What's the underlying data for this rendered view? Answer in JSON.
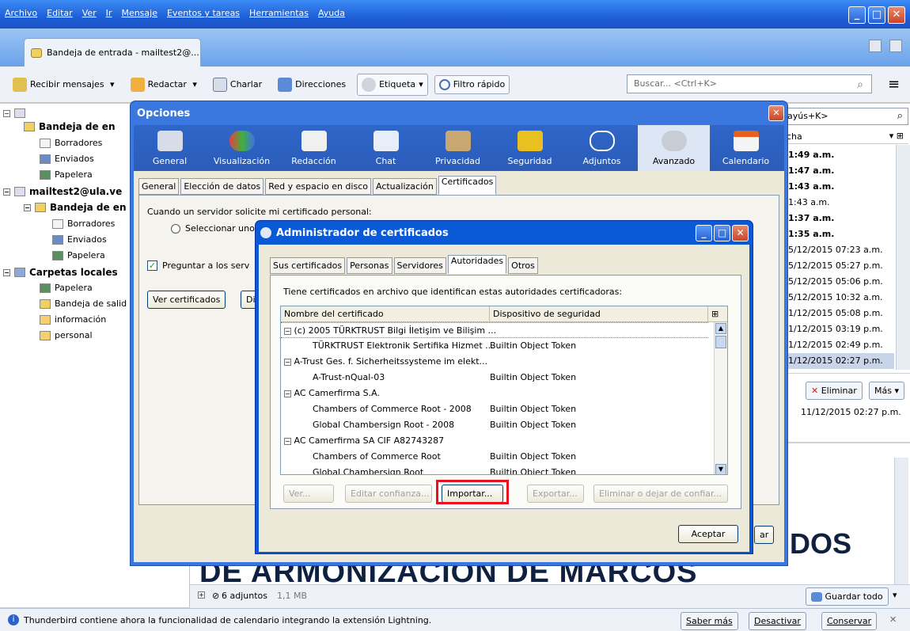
{
  "menu": [
    "Archivo",
    "Editar",
    "Ver",
    "Ir",
    "Mensaje",
    "Eventos y tareas",
    "Herramientas",
    "Ayuda"
  ],
  "tab": {
    "label": "Bandeja de entrada - mailtest2@..."
  },
  "toolbar": {
    "recibir": "Recibir mensajes",
    "redactar": "Redactar",
    "charlar": "Charlar",
    "direcciones": "Direcciones",
    "etiqueta": "Etiqueta",
    "filtro": "Filtro rápido",
    "search_placeholder": "Buscar... <Ctrl+K>"
  },
  "folders": {
    "account1_inbox": "Bandeja de en",
    "account1_borradores": "Borradores",
    "account1_enviados": "Enviados",
    "account1_papelera": "Papelera",
    "account2": "mailtest2@ula.ve",
    "account2_inbox": "Bandeja de en",
    "account2_borradores": "Borradores",
    "account2_enviados": "Enviados",
    "account2_papelera": "Papelera",
    "local": "Carpetas locales",
    "local_papelera": "Papelera",
    "local_salida": "Bandeja de salid",
    "local_informacion": "información",
    "local_personal": "personal"
  },
  "msglist": {
    "search": "ayús+K>",
    "col_fecha": "cha",
    "rows": [
      "1:49 a.m.",
      "1:47 a.m.",
      "1:43 a.m.",
      "1:43 a.m.",
      "1:37 a.m.",
      "1:35 a.m.",
      "5/12/2015 07:23 a.m.",
      "5/12/2015 05:27 p.m.",
      "5/12/2015 05:06 p.m.",
      "5/12/2015 10:32 a.m.",
      "1/12/2015 05:08 p.m.",
      "1/12/2015 03:19 p.m.",
      "1/12/2015 02:49 p.m.",
      "1/12/2015 02:27 p.m."
    ]
  },
  "preview": {
    "eliminar": "Eliminar",
    "mas": "Más",
    "date": "11/12/2015 02:27 p.m.",
    "big1": "DOS",
    "big2": "DE ARMONIZACION DE MARCOS",
    "attachments": "6 adjuntos",
    "att_size": "1,1 MB",
    "guardar_todo": "Guardar todo"
  },
  "status": {
    "message": "Thunderbird contiene ahora la funcionalidad de calendario integrando la extensión Lightning.",
    "saber_mas": "Saber más",
    "desactivar": "Desactivar",
    "conservar": "Conservar"
  },
  "opciones": {
    "title": "Opciones",
    "categories": [
      "General",
      "Visualización",
      "Redacción",
      "Chat",
      "Privacidad",
      "Seguridad",
      "Adjuntos",
      "Avanzado",
      "Calendario"
    ],
    "subtabs": [
      "General",
      "Elección de datos",
      "Red y espacio en disco",
      "Actualización",
      "Certificados"
    ],
    "cert_prompt": "Cuando un servidor solicite mi certificado personal:",
    "radio1": "Seleccionar uno",
    "check1": "Preguntar a los serv",
    "ver_cert": "Ver certificados",
    "dis": "Dis",
    "aceptar_partial": "ar"
  },
  "certmgr": {
    "title": "Administrador de certificados",
    "tabs": [
      "Sus certificados",
      "Personas",
      "Servidores",
      "Autoridades",
      "Otros"
    ],
    "desc": "Tiene certificados en archivo que identifican estas autoridades certificadoras:",
    "col_name": "Nombre del certificado",
    "col_device": "Dispositivo de seguridad",
    "rows": [
      {
        "name": "(c) 2005 TÜRKTRUST Bilgi İletişim ve Bilişim ...",
        "device": "",
        "group": true
      },
      {
        "name": "TÜRKTRUST Elektronik Sertifika Hizmet ...",
        "device": "Builtin Object Token",
        "group": false
      },
      {
        "name": "A-Trust Ges. f. Sicherheitssysteme im elekt...",
        "device": "",
        "group": true
      },
      {
        "name": "A-Trust-nQual-03",
        "device": "Builtin Object Token",
        "group": false
      },
      {
        "name": "AC Camerfirma S.A.",
        "device": "",
        "group": true
      },
      {
        "name": "Chambers of Commerce Root - 2008",
        "device": "Builtin Object Token",
        "group": false
      },
      {
        "name": "Global Chambersign Root - 2008",
        "device": "Builtin Object Token",
        "group": false
      },
      {
        "name": "AC Camerfirma SA CIF A82743287",
        "device": "",
        "group": true
      },
      {
        "name": "Chambers of Commerce Root",
        "device": "Builtin Object Token",
        "group": false
      },
      {
        "name": "Global Chambersign Root",
        "device": "Builtin Object Token",
        "group": false
      }
    ],
    "btn_ver": "Ver...",
    "btn_editar": "Editar confianza...",
    "btn_importar": "Importar...",
    "btn_exportar": "Exportar...",
    "btn_eliminar": "Eliminar o dejar de confiar...",
    "btn_aceptar": "Aceptar"
  }
}
